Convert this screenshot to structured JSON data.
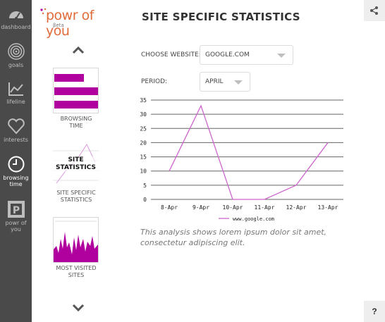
{
  "nav": {
    "items": [
      {
        "label": "dashboard",
        "icon": "dashboard-icon"
      },
      {
        "label": "goals",
        "icon": "target-icon"
      },
      {
        "label": "lifeline",
        "icon": "line-chart-icon"
      },
      {
        "label": "interests",
        "icon": "heart-icon"
      },
      {
        "label": "browsing",
        "label2": "time",
        "icon": "clock-icon"
      },
      {
        "label": "powr of",
        "label2": "you",
        "icon": "powr-p-icon"
      }
    ]
  },
  "brand": {
    "name": "powr of you",
    "tag": "βeta"
  },
  "thumbs": {
    "items": [
      {
        "label1": "BROWSING",
        "label2": "TIME"
      },
      {
        "overlay1": "SITE",
        "overlay2": "STATISTICS",
        "label1": "SITE SPECIFIC",
        "label2": "STATISTICS"
      },
      {
        "label1": "MOST VISITED",
        "label2": "SITES"
      }
    ]
  },
  "main": {
    "title": "SITE SPECIFIC STATISTICS",
    "website_label": "CHOOSE WEBSITE:",
    "website_value": "GOOGLE.COM",
    "period_label": "PERIOD:",
    "period_value": "APRIL",
    "note": "This analysis shows lorem ipsum dolor sit amet, consectetur adipiscing elit."
  },
  "help": {
    "label": "?"
  },
  "colors": {
    "accent": "#b0009e",
    "line": "#cc66cc",
    "nav_bg": "#4a4a4a"
  },
  "chart_data": {
    "type": "line",
    "categories": [
      "8-Apr",
      "9-Apr",
      "10-Apr",
      "11-Apr",
      "12-Apr",
      "13-Apr"
    ],
    "series": [
      {
        "name": "www.google.com",
        "values": [
          10,
          33,
          0,
          0,
          5,
          20
        ]
      }
    ],
    "yticks": [
      0,
      5,
      10,
      15,
      20,
      25,
      30,
      35
    ],
    "ylim": [
      0,
      35
    ],
    "grid": true,
    "legend": "bottom"
  }
}
